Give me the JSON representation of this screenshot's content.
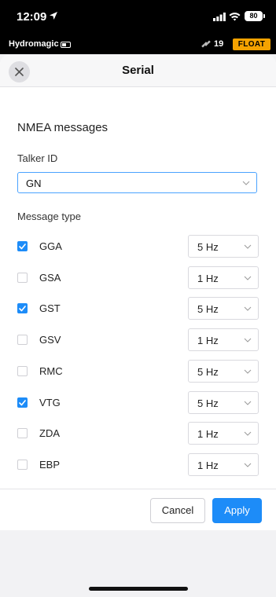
{
  "status_bar": {
    "time": "12:09",
    "battery": "80"
  },
  "app_bar": {
    "app_name": "Hydromagic",
    "satellites": "19",
    "fix_status": "FLOAT"
  },
  "dialog": {
    "title": "Serial",
    "section_title": "NMEA messages",
    "talker_label": "Talker ID",
    "talker_value": "GN",
    "message_type_label": "Message type",
    "messages": [
      {
        "name": "GGA",
        "checked": true,
        "rate": "5 Hz"
      },
      {
        "name": "GSA",
        "checked": false,
        "rate": "1 Hz"
      },
      {
        "name": "GST",
        "checked": true,
        "rate": "5 Hz"
      },
      {
        "name": "GSV",
        "checked": false,
        "rate": "1 Hz"
      },
      {
        "name": "RMC",
        "checked": false,
        "rate": "5 Hz"
      },
      {
        "name": "VTG",
        "checked": true,
        "rate": "5 Hz"
      },
      {
        "name": "ZDA",
        "checked": false,
        "rate": "1 Hz"
      },
      {
        "name": "EBP",
        "checked": false,
        "rate": "1 Hz"
      }
    ],
    "cancel_label": "Cancel",
    "apply_label": "Apply"
  },
  "colors": {
    "accent": "#1d8cf8",
    "fix_badge": "#f5a200"
  },
  "icons": [
    "location-arrow-icon",
    "signal-icon",
    "wifi-icon",
    "battery-icon",
    "satellite-icon",
    "close-icon",
    "chevron-down-icon",
    "checkmark-icon"
  ]
}
